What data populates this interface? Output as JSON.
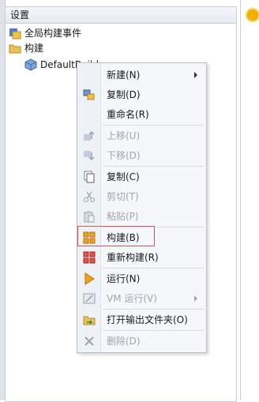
{
  "panel": {
    "title": "设置"
  },
  "tree": {
    "items": [
      {
        "label": "全局构建事件",
        "icon": "event-icon"
      },
      {
        "label": "构建",
        "icon": "folder-icon"
      },
      {
        "label": "DefaultBuild",
        "icon": "build-cube-icon"
      }
    ]
  },
  "menu": {
    "items": [
      {
        "label": "新建(N)",
        "icon": "",
        "disabled": false,
        "submenu": true
      },
      {
        "label": "复制(D)",
        "icon": "duplicate-icon",
        "disabled": false
      },
      {
        "label": "重命名(R)",
        "icon": "",
        "disabled": false
      },
      {
        "label": "上移(U)",
        "icon": "move-up-icon",
        "disabled": true
      },
      {
        "label": "下移(D)",
        "icon": "move-down-icon",
        "disabled": true
      },
      {
        "label": "复制(C)",
        "icon": "copy-icon",
        "disabled": false
      },
      {
        "label": "剪切(T)",
        "icon": "cut-icon",
        "disabled": true
      },
      {
        "label": "粘贴(P)",
        "icon": "paste-icon",
        "disabled": true
      },
      {
        "label": "构建(B)",
        "icon": "build-icon",
        "disabled": false,
        "highlighted": true
      },
      {
        "label": "重新构建(R)",
        "icon": "rebuild-icon",
        "disabled": false
      },
      {
        "label": "运行(N)",
        "icon": "run-icon",
        "disabled": false
      },
      {
        "label": "VM 运行(V)",
        "icon": "vm-run-icon",
        "disabled": true,
        "submenu": true
      },
      {
        "label": "打开输出文件夹(O)",
        "icon": "open-folder-icon",
        "disabled": false
      },
      {
        "label": "删除(D)",
        "icon": "delete-icon",
        "disabled": true
      }
    ]
  },
  "colors": {
    "highlight_border": "#e05555",
    "disabled_text": "#a0a5ab"
  }
}
